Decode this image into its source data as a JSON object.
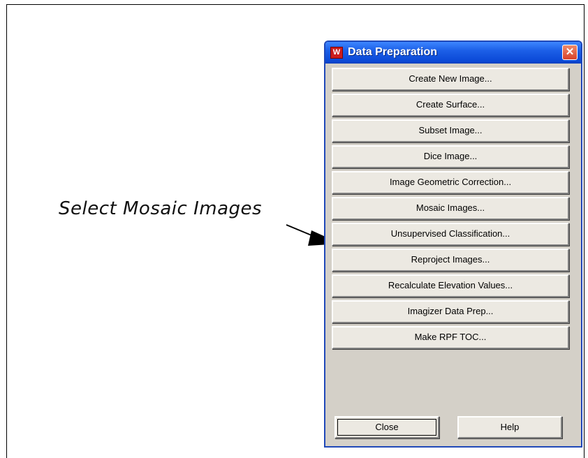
{
  "annotation": {
    "text": "Select Mosaic Images"
  },
  "window": {
    "title": "Data Preparation",
    "close_glyph": "✕",
    "icon": "app-logo-icon"
  },
  "menu": [
    {
      "label": "Create New Image..."
    },
    {
      "label": "Create Surface..."
    },
    {
      "label": "Subset Image..."
    },
    {
      "label": "Dice Image..."
    },
    {
      "label": "Image Geometric Correction..."
    },
    {
      "label": "Mosaic Images..."
    },
    {
      "label": "Unsupervised Classification..."
    },
    {
      "label": "Reproject Images..."
    },
    {
      "label": "Recalculate Elevation Values..."
    },
    {
      "label": "Imagizer Data Prep..."
    },
    {
      "label": "Make RPF TOC..."
    }
  ],
  "footer": {
    "close_label": "Close",
    "help_label": "Help"
  },
  "colors": {
    "titlebar": "#0a48d6",
    "window_bg": "#d4d0c8",
    "close_button": "#d8412a"
  }
}
